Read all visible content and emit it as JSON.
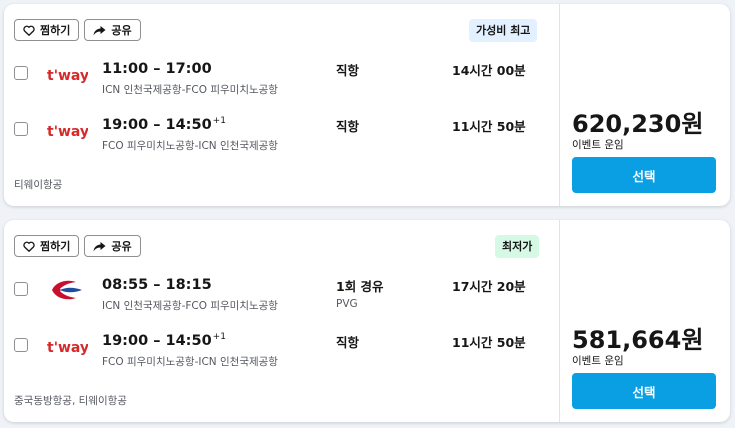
{
  "results": [
    {
      "favorite_label": "찜하기",
      "share_label": "공유",
      "badge": "가성비 최고",
      "badge_color": "#e3f0ff",
      "legs": [
        {
          "airline_logo": "tway-logo",
          "times": "11:00 – 17:00",
          "day_offset": "",
          "route": "ICN 인천국제공항-FCO 피우미치노공항",
          "stops": "직항",
          "stop_city": "",
          "duration": "14시간 00분"
        },
        {
          "airline_logo": "tway-logo",
          "times": "19:00 – 14:50",
          "day_offset": "+1",
          "route": "FCO 피우미치노공항-ICN 인천국제공항",
          "stops": "직항",
          "stop_city": "",
          "duration": "11시간 50분"
        }
      ],
      "airlines": "티웨이항공",
      "price": "620,230원",
      "fare_type": "이벤트 운임",
      "select_label": "선택"
    },
    {
      "favorite_label": "찜하기",
      "share_label": "공유",
      "badge": "최저가",
      "badge_color": "#d6f9e6",
      "legs": [
        {
          "airline_logo": "china-eastern-logo",
          "times": "08:55 – 18:15",
          "day_offset": "",
          "route": "ICN 인천국제공항-FCO 피우미치노공항",
          "stops": "1회 경유",
          "stop_city": "PVG",
          "duration": "17시간 20분"
        },
        {
          "airline_logo": "tway-logo",
          "times": "19:00 – 14:50",
          "day_offset": "+1",
          "route": "FCO 피우미치노공항-ICN 인천국제공항",
          "stops": "직항",
          "stop_city": "",
          "duration": "11시간 50분"
        }
      ],
      "airlines": "중국동방항공, 티웨이항공",
      "price": "581,664원",
      "fare_type": "이벤트 운임",
      "select_label": "선택"
    }
  ],
  "colors": {
    "select_button": "#0a9fe3",
    "tway_red": "#d62a2a",
    "china_eastern_red": "#c8102e",
    "china_eastern_blue": "#1d4e9e"
  }
}
